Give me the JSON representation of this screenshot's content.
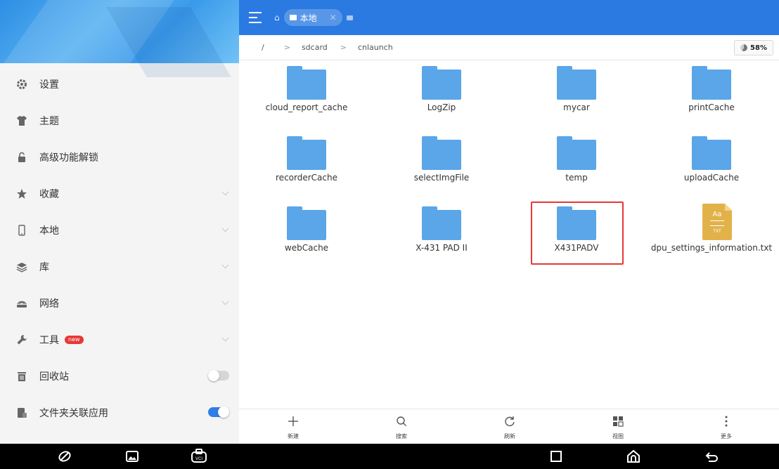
{
  "sidebar": {
    "items": [
      {
        "label": "设置",
        "icon": "gear-icon"
      },
      {
        "label": "主题",
        "icon": "tshirt-icon"
      },
      {
        "label": "高级功能解锁",
        "icon": "unlock-icon"
      },
      {
        "label": "收藏",
        "icon": "star-icon"
      },
      {
        "label": "本地",
        "icon": "phone-icon"
      },
      {
        "label": "库",
        "icon": "layers-icon"
      },
      {
        "label": "网络",
        "icon": "network-icon"
      },
      {
        "label": "工具",
        "icon": "wrench-icon",
        "badge": "new"
      },
      {
        "label": "回收站",
        "icon": "trash-icon",
        "toggle": false
      },
      {
        "label": "文件夹关联应用",
        "icon": "folder-app-icon",
        "toggle": true
      }
    ]
  },
  "topbar": {
    "tab_label": "本地"
  },
  "path": {
    "root": "/",
    "segments": [
      "sdcard",
      "cnlaunch"
    ],
    "storage_percent": "58%"
  },
  "files": [
    {
      "name": "cloud_report_cache",
      "type": "folder"
    },
    {
      "name": "LogZip",
      "type": "folder"
    },
    {
      "name": "mycar",
      "type": "folder"
    },
    {
      "name": "printCache",
      "type": "folder"
    },
    {
      "name": "recorderCache",
      "type": "folder"
    },
    {
      "name": "selectImgFile",
      "type": "folder"
    },
    {
      "name": "temp",
      "type": "folder"
    },
    {
      "name": "uploadCache",
      "type": "folder"
    },
    {
      "name": "webCache",
      "type": "folder"
    },
    {
      "name": "X-431 PAD II",
      "type": "folder"
    },
    {
      "name": "X431PADV",
      "type": "folder",
      "highlighted": true
    },
    {
      "name": "dpu_settings_information.txt",
      "type": "txt",
      "icon_text": "Aa",
      "ext": "TXT"
    }
  ],
  "actions": [
    {
      "label": "新建",
      "icon": "plus-icon"
    },
    {
      "label": "搜索",
      "icon": "search-icon"
    },
    {
      "label": "刷新",
      "icon": "refresh-icon"
    },
    {
      "label": "视图",
      "icon": "grid-view-icon"
    },
    {
      "label": "更多",
      "icon": "more-icon"
    }
  ],
  "colors": {
    "topbar": "#2a7ae2",
    "folder": "#5aa6e8",
    "toggle_on": "#2f7de8",
    "highlight": "#e53935"
  }
}
